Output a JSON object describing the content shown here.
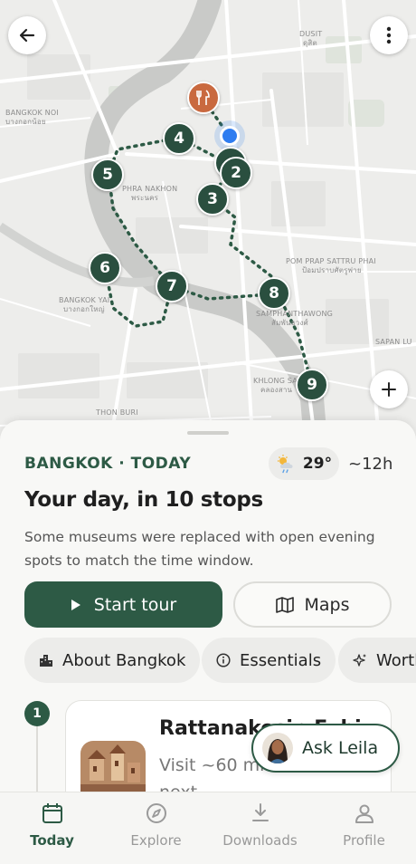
{
  "map": {
    "labels": [
      {
        "text": "BANGKOK NOI",
        "id": "bangkok-noi"
      },
      {
        "text": "บางกอกน้อย",
        "id": "bangkok-noi-th"
      },
      {
        "text": "DUSIT",
        "id": "dusit"
      },
      {
        "text": "ดุสิต",
        "id": "dusit-th"
      },
      {
        "text": "PHRA NAKHON",
        "id": "phra-nakhon"
      },
      {
        "text": "พระนคร",
        "id": "phra-nakhon-th"
      },
      {
        "text": "POM PRAP SATTRU PHAI",
        "id": "pom-prap"
      },
      {
        "text": "ป้อมปราบศัตรูพ่าย",
        "id": "pom-prap-th"
      },
      {
        "text": "BANGKOK YAI",
        "id": "bangkok-yai"
      },
      {
        "text": "บางกอกใหญ่",
        "id": "bangkok-yai-th"
      },
      {
        "text": "SAMPHANTHAWONG",
        "id": "samphanthawong"
      },
      {
        "text": "สัมพันธวงศ์",
        "id": "samphanthawong-th"
      },
      {
        "text": "SAPAN LU",
        "id": "sapan-lu"
      },
      {
        "text": "KHLONG SA",
        "id": "khlong-san"
      },
      {
        "text": "คลองสาน",
        "id": "khlong-san-th"
      },
      {
        "text": "THON BURI",
        "id": "thon-buri"
      }
    ],
    "stops": [
      "2",
      "3",
      "4",
      "5",
      "6",
      "7",
      "8",
      "9"
    ]
  },
  "sheet": {
    "location": "BANGKOK · TODAY",
    "temperature": "29°",
    "duration": "~12h",
    "headline": "Your day, in 10 stops",
    "subtext": "Some museums were replaced with open evening spots to match the time window.",
    "start_tour": "Start tour",
    "maps": "Maps",
    "chips": [
      "About Bangkok",
      "Essentials",
      "Worth"
    ],
    "first_stop": {
      "number": "1",
      "name": "Rattanakosin Exhi",
      "description": "Visit ~60 min, then walk next"
    },
    "ask_label": "Ask Leila"
  },
  "nav": {
    "items": [
      {
        "label": "Today",
        "icon": "calendar-icon"
      },
      {
        "label": "Explore",
        "icon": "compass-icon"
      },
      {
        "label": "Downloads",
        "icon": "download-icon"
      },
      {
        "label": "Profile",
        "icon": "person-icon"
      }
    ]
  },
  "colors": {
    "accent": "#2d5a45",
    "food": "#c9693f",
    "location": "#2f7df0"
  }
}
